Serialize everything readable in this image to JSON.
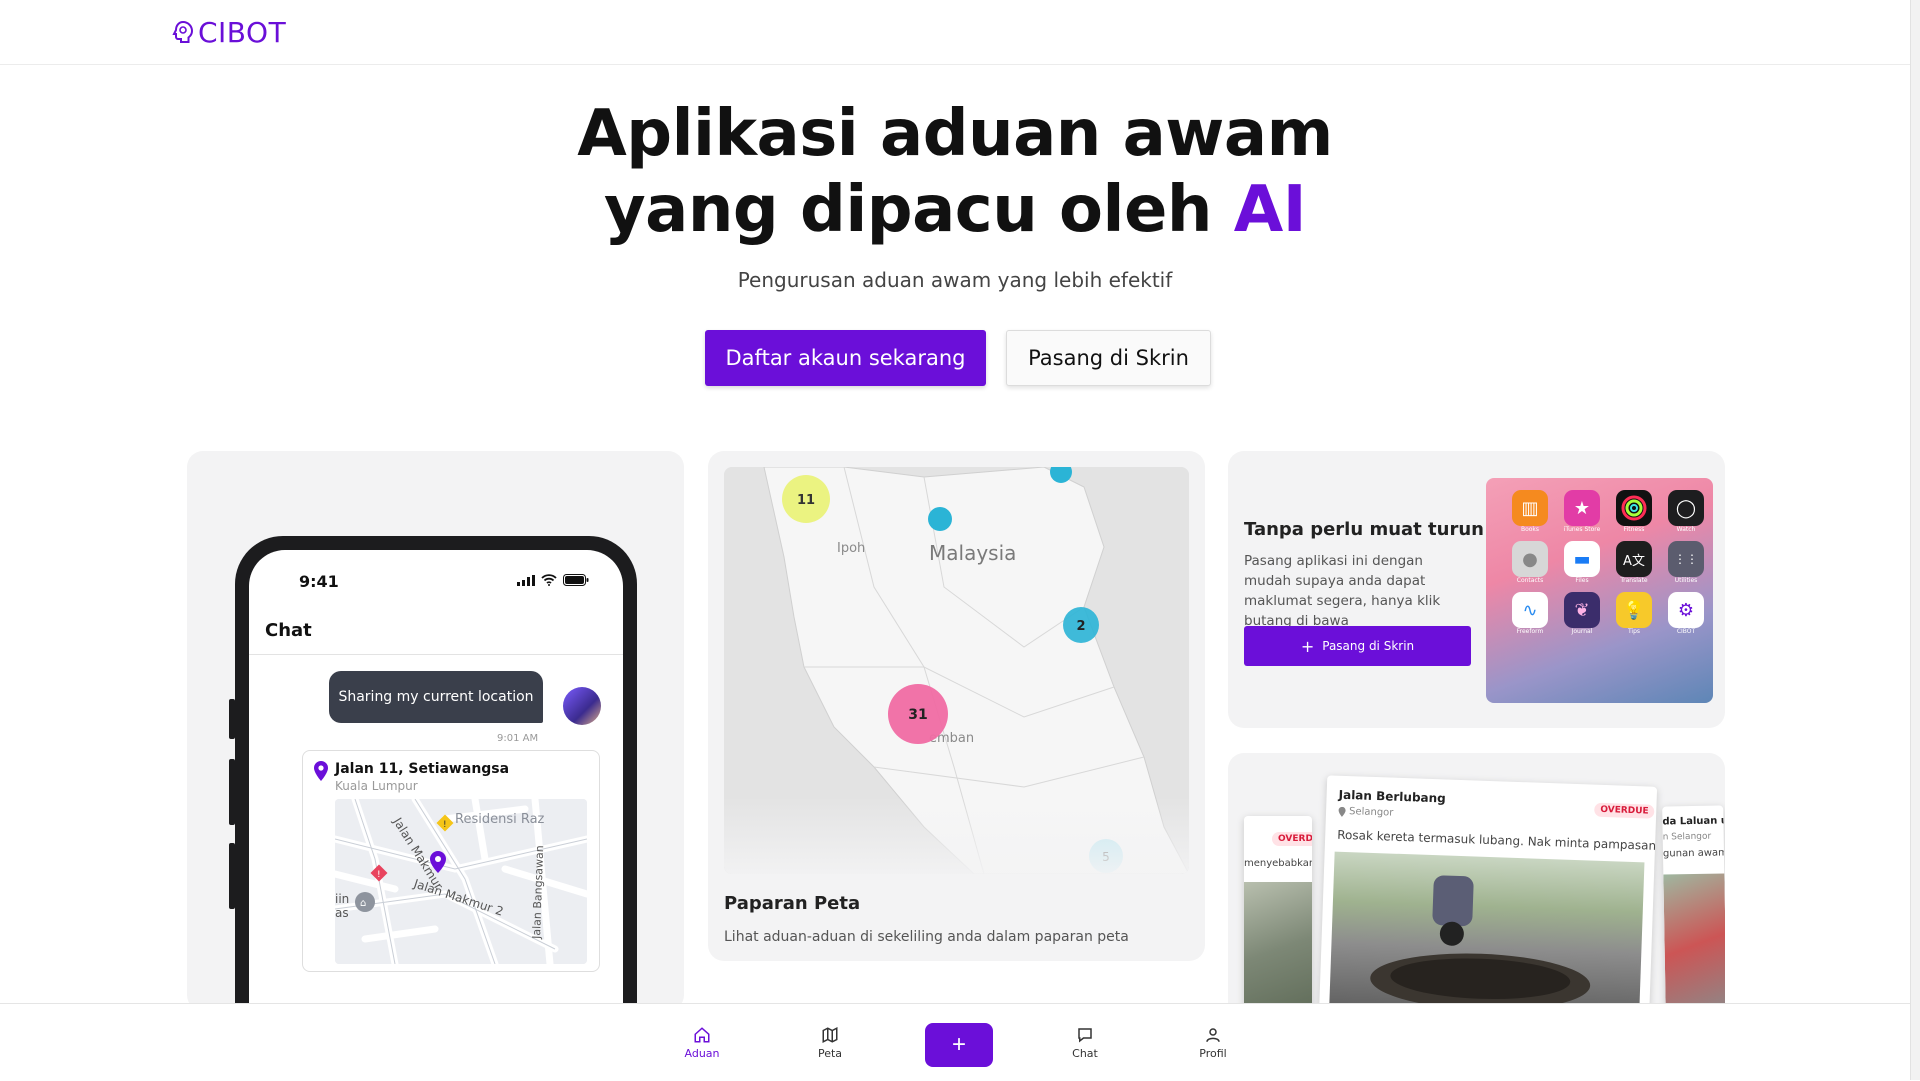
{
  "header": {
    "logo_text": "CIBOT"
  },
  "hero": {
    "title_line1": "Aplikasi aduan awam",
    "title_line2": "yang dipacu oleh",
    "title_highlight": "AI",
    "subtitle": "Pengurusan aduan awam yang lebih efektif",
    "primary_button": "Daftar akaun sekarang",
    "secondary_button": "Pasang di Skrin"
  },
  "chat_card": {
    "time": "9:41",
    "title": "Chat",
    "message": "Sharing my current location",
    "message_time": "9:01 AM",
    "location_name": "Jalan 11, Setiawangsa",
    "location_area": "Kuala Lumpur",
    "map_labels": [
      "Residensi Raz",
      "Jalan Makmur",
      "Jalan Makmur 2",
      "Jalan Bangsawan",
      "iin",
      "as"
    ]
  },
  "map_card": {
    "title": "Paparan Peta",
    "description": "Lihat aduan-aduan di sekeliling anda dalam paparan peta",
    "labels": {
      "country": "Malaysia",
      "city1": "Ipoh",
      "city2": "emban"
    },
    "clusters": [
      "11",
      "2",
      "31",
      "5"
    ]
  },
  "install_card": {
    "title": "Tanpa perlu muat turun",
    "description": "Pasang aplikasi ini dengan mudah supaya anda dapat maklumat segera, hanya klik butang di bawa",
    "button": "Pasang di Skrin",
    "apps": [
      "Books",
      "iTunes Store",
      "Fitness",
      "Watch",
      "Contacts",
      "Files",
      "Translate",
      "Utilities",
      "Freeform",
      "Journal",
      "Tips",
      "CIBOT"
    ]
  },
  "feed_card": {
    "main_title": "Jalan Berlubang",
    "main_location": "Selangor",
    "main_badge": "OVERDUE",
    "main_text": "Rosak kereta termasuk lubang. Nak minta pampasan....",
    "left_badge": "OVERDUE",
    "left_text": "menyebabkan...",
    "right_title": "da Laluan unt",
    "right_location": "n Selangor",
    "right_text": "gunan awam"
  },
  "bottom_nav": {
    "items": [
      "Aduan",
      "Peta",
      "Chat",
      "Profil"
    ],
    "add_label": "+"
  },
  "colors": {
    "accent": "#6b0fd9",
    "card_bg": "#f3f3f4",
    "cluster_yellow": "#eaf27a",
    "cluster_blue": "#2bb4d6",
    "cluster_pink": "#f06ba3"
  }
}
